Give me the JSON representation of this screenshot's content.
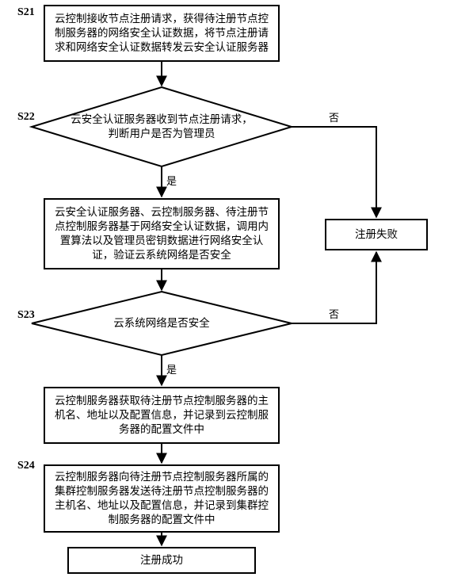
{
  "steps": {
    "s21": "S21",
    "s22": "S22",
    "s23": "S23",
    "s24": "S24"
  },
  "nodes": {
    "n1": "云控制接收节点注册请求，获得待注册节点控制服务器的网络安全认证数据，将节点注册请求和网络安全认证数据转发云安全认证服务器",
    "d1": "云安全认证服务器收到节点注册请求，判断用户是否为管理员",
    "n2": "云安全认证服务器、云控制服务器、待注册节点控制服务器基于网络安全认证数据，调用内置算法以及管理员密钥数据进行网络安全认证，验证云系统网络是否安全",
    "d2": "云系统网络是否安全",
    "n3": "云控制服务器获取待注册节点控制服务器的主机名、地址以及配置信息，并记录到云控制服务器的配置文件中",
    "n4": "云控制服务器向待注册节点控制服务器所属的集群控制服务器发送待注册节点控制服务器的主机名、地址以及配置信息，并记录到集群控制服务器的配置文件中",
    "fail": "注册失败",
    "succ": "注册成功"
  },
  "edges": {
    "yes": "是",
    "no": "否"
  }
}
